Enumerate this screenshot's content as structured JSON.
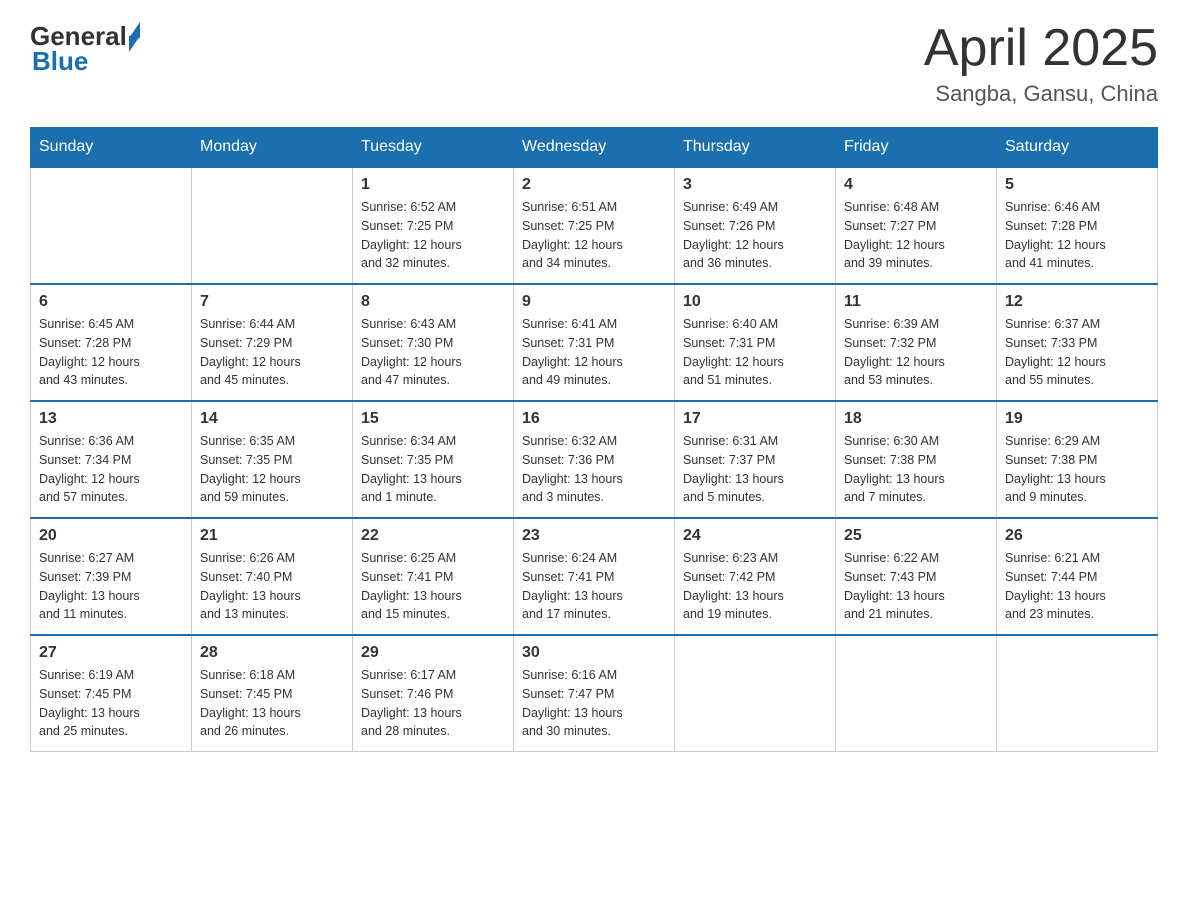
{
  "header": {
    "logo_general": "General",
    "logo_blue": "Blue",
    "month": "April 2025",
    "location": "Sangba, Gansu, China"
  },
  "weekdays": [
    "Sunday",
    "Monday",
    "Tuesday",
    "Wednesday",
    "Thursday",
    "Friday",
    "Saturday"
  ],
  "weeks": [
    [
      {
        "day": "",
        "info": ""
      },
      {
        "day": "",
        "info": ""
      },
      {
        "day": "1",
        "info": "Sunrise: 6:52 AM\nSunset: 7:25 PM\nDaylight: 12 hours\nand 32 minutes."
      },
      {
        "day": "2",
        "info": "Sunrise: 6:51 AM\nSunset: 7:25 PM\nDaylight: 12 hours\nand 34 minutes."
      },
      {
        "day": "3",
        "info": "Sunrise: 6:49 AM\nSunset: 7:26 PM\nDaylight: 12 hours\nand 36 minutes."
      },
      {
        "day": "4",
        "info": "Sunrise: 6:48 AM\nSunset: 7:27 PM\nDaylight: 12 hours\nand 39 minutes."
      },
      {
        "day": "5",
        "info": "Sunrise: 6:46 AM\nSunset: 7:28 PM\nDaylight: 12 hours\nand 41 minutes."
      }
    ],
    [
      {
        "day": "6",
        "info": "Sunrise: 6:45 AM\nSunset: 7:28 PM\nDaylight: 12 hours\nand 43 minutes."
      },
      {
        "day": "7",
        "info": "Sunrise: 6:44 AM\nSunset: 7:29 PM\nDaylight: 12 hours\nand 45 minutes."
      },
      {
        "day": "8",
        "info": "Sunrise: 6:43 AM\nSunset: 7:30 PM\nDaylight: 12 hours\nand 47 minutes."
      },
      {
        "day": "9",
        "info": "Sunrise: 6:41 AM\nSunset: 7:31 PM\nDaylight: 12 hours\nand 49 minutes."
      },
      {
        "day": "10",
        "info": "Sunrise: 6:40 AM\nSunset: 7:31 PM\nDaylight: 12 hours\nand 51 minutes."
      },
      {
        "day": "11",
        "info": "Sunrise: 6:39 AM\nSunset: 7:32 PM\nDaylight: 12 hours\nand 53 minutes."
      },
      {
        "day": "12",
        "info": "Sunrise: 6:37 AM\nSunset: 7:33 PM\nDaylight: 12 hours\nand 55 minutes."
      }
    ],
    [
      {
        "day": "13",
        "info": "Sunrise: 6:36 AM\nSunset: 7:34 PM\nDaylight: 12 hours\nand 57 minutes."
      },
      {
        "day": "14",
        "info": "Sunrise: 6:35 AM\nSunset: 7:35 PM\nDaylight: 12 hours\nand 59 minutes."
      },
      {
        "day": "15",
        "info": "Sunrise: 6:34 AM\nSunset: 7:35 PM\nDaylight: 13 hours\nand 1 minute."
      },
      {
        "day": "16",
        "info": "Sunrise: 6:32 AM\nSunset: 7:36 PM\nDaylight: 13 hours\nand 3 minutes."
      },
      {
        "day": "17",
        "info": "Sunrise: 6:31 AM\nSunset: 7:37 PM\nDaylight: 13 hours\nand 5 minutes."
      },
      {
        "day": "18",
        "info": "Sunrise: 6:30 AM\nSunset: 7:38 PM\nDaylight: 13 hours\nand 7 minutes."
      },
      {
        "day": "19",
        "info": "Sunrise: 6:29 AM\nSunset: 7:38 PM\nDaylight: 13 hours\nand 9 minutes."
      }
    ],
    [
      {
        "day": "20",
        "info": "Sunrise: 6:27 AM\nSunset: 7:39 PM\nDaylight: 13 hours\nand 11 minutes."
      },
      {
        "day": "21",
        "info": "Sunrise: 6:26 AM\nSunset: 7:40 PM\nDaylight: 13 hours\nand 13 minutes."
      },
      {
        "day": "22",
        "info": "Sunrise: 6:25 AM\nSunset: 7:41 PM\nDaylight: 13 hours\nand 15 minutes."
      },
      {
        "day": "23",
        "info": "Sunrise: 6:24 AM\nSunset: 7:41 PM\nDaylight: 13 hours\nand 17 minutes."
      },
      {
        "day": "24",
        "info": "Sunrise: 6:23 AM\nSunset: 7:42 PM\nDaylight: 13 hours\nand 19 minutes."
      },
      {
        "day": "25",
        "info": "Sunrise: 6:22 AM\nSunset: 7:43 PM\nDaylight: 13 hours\nand 21 minutes."
      },
      {
        "day": "26",
        "info": "Sunrise: 6:21 AM\nSunset: 7:44 PM\nDaylight: 13 hours\nand 23 minutes."
      }
    ],
    [
      {
        "day": "27",
        "info": "Sunrise: 6:19 AM\nSunset: 7:45 PM\nDaylight: 13 hours\nand 25 minutes."
      },
      {
        "day": "28",
        "info": "Sunrise: 6:18 AM\nSunset: 7:45 PM\nDaylight: 13 hours\nand 26 minutes."
      },
      {
        "day": "29",
        "info": "Sunrise: 6:17 AM\nSunset: 7:46 PM\nDaylight: 13 hours\nand 28 minutes."
      },
      {
        "day": "30",
        "info": "Sunrise: 6:16 AM\nSunset: 7:47 PM\nDaylight: 13 hours\nand 30 minutes."
      },
      {
        "day": "",
        "info": ""
      },
      {
        "day": "",
        "info": ""
      },
      {
        "day": "",
        "info": ""
      }
    ]
  ]
}
